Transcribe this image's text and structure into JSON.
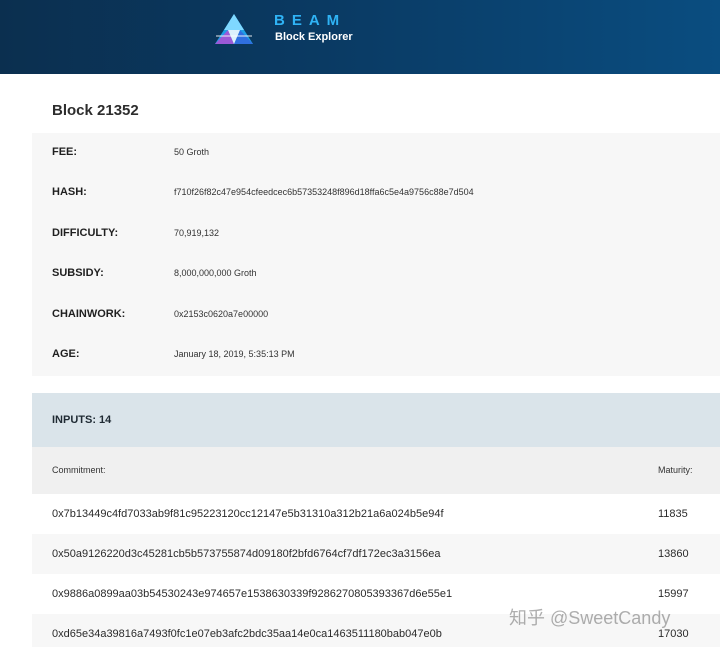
{
  "header": {
    "brand": "BEAM",
    "subtitle": "Block Explorer",
    "colors": {
      "accent": "#2fb3f5",
      "header_bg": "#0a3a63"
    }
  },
  "block": {
    "title": "Block 21352"
  },
  "details": [
    {
      "label": "FEE:",
      "value": "50 Groth"
    },
    {
      "label": "HASH:",
      "value": "f710f26f82c47e954cfeedcec6b57353248f896d18ffa6c5e4a9756c88e7d504"
    },
    {
      "label": "DIFFICULTY:",
      "value": "70,919,132"
    },
    {
      "label": "SUBSIDY:",
      "value": "8,000,000,000 Groth"
    },
    {
      "label": "CHAINWORK:",
      "value": "0x2153c0620a7e00000"
    },
    {
      "label": "AGE:",
      "value": "January 18, 2019, 5:35:13 PM"
    }
  ],
  "inputs": {
    "title": "INPUTS: 14",
    "columns": {
      "commitment": "Commitment:",
      "maturity": "Maturity:"
    },
    "rows": [
      {
        "commitment": "0x7b13449c4fd7033ab9f81c95223120cc12147e5b31310a312b21a6a024b5e94f",
        "maturity": "11835"
      },
      {
        "commitment": "0x50a9126220d3c45281cb5b573755874d09180f2bfd6764cf7df172ec3a3156ea",
        "maturity": "13860"
      },
      {
        "commitment": "0x9886a0899aa03b54530243e974657e1538630339f9286270805393367d6e55e1",
        "maturity": "15997"
      },
      {
        "commitment": "0xd65e34a39816a7493f0fc1e07eb3afc2bdc35aa14e0ca1463511180bab047e0b",
        "maturity": "17030"
      }
    ]
  },
  "watermark": "知乎 @SweetCandy"
}
